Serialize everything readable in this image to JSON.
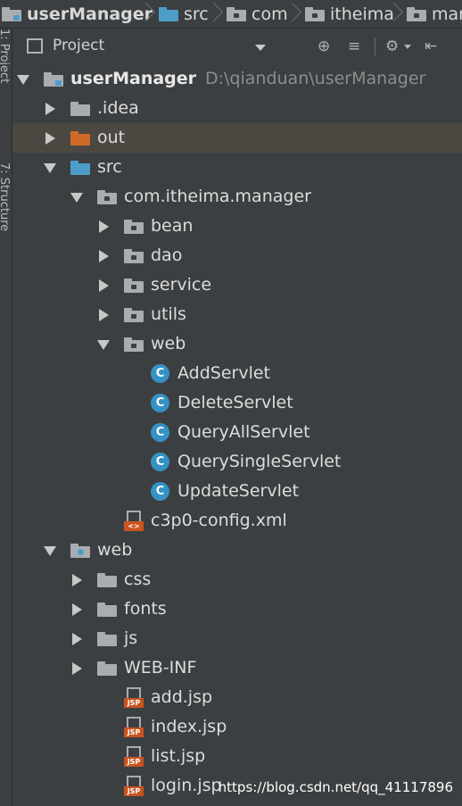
{
  "breadcrumb": [
    "userManager",
    "src",
    "com",
    "itheima",
    "man"
  ],
  "side_tabs": {
    "project": "1: Project",
    "structure": "7: Structure"
  },
  "panel": {
    "title": "Project",
    "icons": [
      "globe-icon",
      "collapse-icon",
      "gear-icon",
      "hide-icon"
    ]
  },
  "tree": [
    {
      "label": "userManager",
      "path": "D:\\qianduan\\userManager",
      "depth": 0,
      "icon": "module-folder",
      "expanded": true,
      "bold": true
    },
    {
      "label": ".idea",
      "depth": 1,
      "icon": "folder",
      "expanded": false
    },
    {
      "label": "out",
      "depth": 1,
      "icon": "folder-excluded",
      "expanded": false,
      "selected": true
    },
    {
      "label": "src",
      "depth": 1,
      "icon": "folder-source",
      "expanded": true
    },
    {
      "label": "com.itheima.manager",
      "depth": 2,
      "icon": "package",
      "expanded": true
    },
    {
      "label": "bean",
      "depth": 3,
      "icon": "package",
      "expanded": false
    },
    {
      "label": "dao",
      "depth": 3,
      "icon": "package",
      "expanded": false
    },
    {
      "label": "service",
      "depth": 3,
      "icon": "package",
      "expanded": false
    },
    {
      "label": "utils",
      "depth": 3,
      "icon": "package",
      "expanded": false
    },
    {
      "label": "web",
      "depth": 3,
      "icon": "package",
      "expanded": true
    },
    {
      "label": "AddServlet",
      "depth": 4,
      "icon": "class"
    },
    {
      "label": "DeleteServlet",
      "depth": 4,
      "icon": "class"
    },
    {
      "label": "QueryAllServlet",
      "depth": 4,
      "icon": "class"
    },
    {
      "label": "QuerySingleServlet",
      "depth": 4,
      "icon": "class"
    },
    {
      "label": "UpdateServlet",
      "depth": 4,
      "icon": "class"
    },
    {
      "label": "c3p0-config.xml",
      "depth": 3,
      "icon": "xml-file"
    },
    {
      "label": "web",
      "depth": 1,
      "icon": "web-folder",
      "expanded": true
    },
    {
      "label": "css",
      "depth": 2,
      "icon": "folder",
      "expanded": false
    },
    {
      "label": "fonts",
      "depth": 2,
      "icon": "folder",
      "expanded": false
    },
    {
      "label": "js",
      "depth": 2,
      "icon": "folder",
      "expanded": false
    },
    {
      "label": "WEB-INF",
      "depth": 2,
      "icon": "folder",
      "expanded": false
    },
    {
      "label": "add.jsp",
      "depth": 3,
      "icon": "jsp-file"
    },
    {
      "label": "index.jsp",
      "depth": 3,
      "icon": "jsp-file"
    },
    {
      "label": "list.jsp",
      "depth": 3,
      "icon": "jsp-file"
    },
    {
      "label": "login.jsp",
      "depth": 3,
      "icon": "jsp-file"
    }
  ],
  "icon_glyphs": {
    "class": "C",
    "jsp": "JSP",
    "xml": "<>"
  },
  "watermark": "https://blog.csdn.net/qq_41117896",
  "colors": {
    "background": "#3c3f41",
    "selected_row": "#4b4842",
    "source_folder": "#4e9dc8",
    "excluded_folder": "#d0692a",
    "class_icon": "#3592c4"
  }
}
